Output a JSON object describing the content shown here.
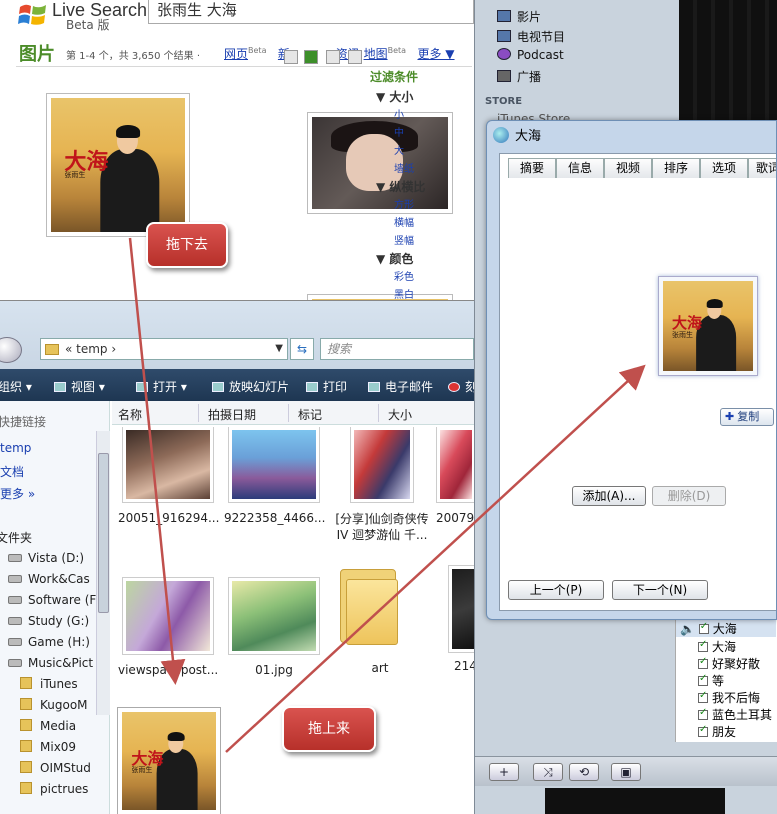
{
  "live_search": {
    "logo_text": "Live Search",
    "logo_sub": "Beta 版",
    "query": "张雨生 大海",
    "vertical": "图片",
    "count_text": "第 1-4 个，共 3,650 个结果 ·",
    "nav": [
      {
        "label": "网页",
        "sup": "Beta"
      },
      {
        "label": "新",
        "sup": ""
      },
      {
        "label": "资讯",
        "sup": ""
      },
      {
        "label": "地图",
        "sup": "Beta"
      },
      {
        "label": "更多 ▼",
        "sup": ""
      }
    ],
    "filters": {
      "title": "过滤条件",
      "size_header": "▼ 大小",
      "size_links": [
        "小",
        "中",
        "大",
        "墙纸"
      ],
      "aspect_header": "▼ 纵横比",
      "aspect_links": [
        "方形",
        "横幅",
        "竖幅"
      ],
      "color_header": "▼ 颜色",
      "color_links": [
        "彩色",
        "黑白"
      ]
    },
    "album_caption_big": "大海",
    "album_caption_small": "张雨生"
  },
  "explorer": {
    "address_label": "«  temp  ›",
    "search_placeholder": "搜索",
    "toolbar": [
      "组织 ▾",
      "视图 ▾",
      "打开 ▾",
      "放映幻灯片",
      "打印",
      "电子邮件",
      "刻"
    ],
    "left_pane": {
      "favorites_label": "快捷链接",
      "links": [
        "temp",
        "文档",
        "更多  »"
      ],
      "folders_label": "文件夹",
      "drives": [
        "Vista (D:)",
        "Work&Cas",
        "Software (F",
        "Study (G:)",
        "Game (H:)",
        "Music&Pict"
      ],
      "subfolders": [
        "iTunes",
        "KugooM",
        "Media",
        "Mix09",
        "OIMStud",
        "pictrues"
      ]
    },
    "columns": [
      "名称",
      "拍摄日期",
      "标记",
      "大小"
    ],
    "files_row1": [
      "20051_916294...",
      "9222358_4466...",
      "[分享]仙剑奇侠传IV 迴梦游仙 千...",
      "20079..."
    ],
    "files_row2": [
      "viewspacepost...",
      "01.jpg",
      "art",
      "214"
    ]
  },
  "itunes": {
    "sources": [
      "影片",
      "电视节目",
      "Podcast",
      "广播"
    ],
    "store_label": "STORE",
    "store_item": "iTunes Store",
    "songs": [
      "大海",
      "大海",
      "好聚好散",
      "等",
      "我不后悔",
      "蓝色土耳其",
      "朋友"
    ],
    "bottom_buttons": [
      "+",
      "⤨",
      "⟲",
      "▣"
    ]
  },
  "dialog": {
    "title": "大海",
    "tabs": [
      "摘要",
      "信息",
      "视频",
      "排序",
      "选项",
      "歌词"
    ],
    "copy_label": "复制",
    "add_label": "添加(A)...",
    "delete_label": "删除(D)",
    "prev_label": "上一个(P)",
    "next_label": "下一个(N)"
  },
  "annotations": {
    "drag_down": "拖下去",
    "drag_up": "拖上来",
    "callout_color": "#c0392b",
    "arrow_color": "#c0504d"
  }
}
